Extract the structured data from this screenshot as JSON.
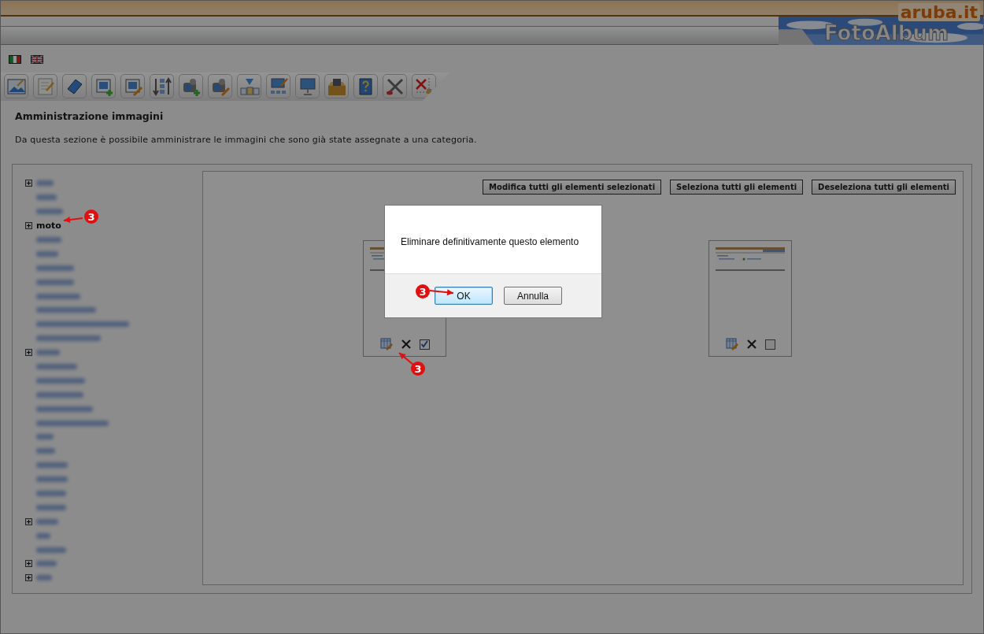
{
  "header": {
    "brand": "aruba.it",
    "title": "FotoAlbum"
  },
  "languages": [
    {
      "kind": "italian"
    },
    {
      "kind": "english"
    }
  ],
  "toolbar": [
    {
      "kind": "gallery"
    },
    {
      "kind": "notes"
    },
    {
      "kind": "book"
    },
    {
      "kind": "image-add"
    },
    {
      "kind": "image-edit"
    },
    {
      "kind": "sort"
    },
    {
      "kind": "camera-add"
    },
    {
      "kind": "camera-edit"
    },
    {
      "kind": "upload"
    },
    {
      "kind": "monitor-edit"
    },
    {
      "kind": "monitor"
    },
    {
      "kind": "box"
    },
    {
      "kind": "help"
    },
    {
      "kind": "tools"
    },
    {
      "kind": "delete"
    }
  ],
  "page": {
    "title": "Amministrazione immagini",
    "description": "Da questa sezione è possibile amministrare le immagini che sono già state assegnate a una categoria."
  },
  "tree": [
    {
      "kind": "blurred",
      "expandable": true
    },
    {
      "kind": "blurred",
      "expandable": false
    },
    {
      "kind": "blurred",
      "expandable": false
    },
    {
      "kind": "label",
      "label": "moto",
      "expandable": true
    },
    {
      "kind": "blurred",
      "expandable": false
    },
    {
      "kind": "blurred",
      "expandable": false
    },
    {
      "kind": "blurred",
      "expandable": false
    },
    {
      "kind": "blurred",
      "expandable": false
    },
    {
      "kind": "blurred",
      "expandable": false
    },
    {
      "kind": "blurred",
      "expandable": false
    },
    {
      "kind": "blurred",
      "expandable": false
    },
    {
      "kind": "blurred",
      "expandable": false
    },
    {
      "kind": "blurred",
      "expandable": true
    },
    {
      "kind": "blurred",
      "expandable": false
    },
    {
      "kind": "blurred",
      "expandable": false
    },
    {
      "kind": "blurred",
      "expandable": false
    },
    {
      "kind": "blurred",
      "expandable": false
    },
    {
      "kind": "blurred",
      "expandable": false
    },
    {
      "kind": "blurred",
      "expandable": false
    },
    {
      "kind": "blurred",
      "expandable": false
    },
    {
      "kind": "blurred",
      "expandable": false
    },
    {
      "kind": "blurred",
      "expandable": false
    },
    {
      "kind": "blurred",
      "expandable": false
    },
    {
      "kind": "blurred",
      "expandable": false
    },
    {
      "kind": "blurred",
      "expandable": true
    },
    {
      "kind": "blurred",
      "expandable": false
    },
    {
      "kind": "blurred",
      "expandable": false
    },
    {
      "kind": "blurred",
      "expandable": true
    },
    {
      "kind": "blurred",
      "expandable": true
    }
  ],
  "actions": [
    "Modifica tutti gli elementi selezionati",
    "Seleziona tutti gli elementi",
    "Deseleziona tutti gli elementi"
  ],
  "items": [
    {
      "kind": "picture",
      "checked": true
    },
    {
      "kind": "picture",
      "checked": false
    }
  ],
  "dialog": {
    "message": "Eliminare definitivamente questo elemento",
    "buttons": [
      "OK",
      "Annulla"
    ]
  },
  "annotations": [
    {
      "label": "3"
    },
    {
      "label": "3"
    },
    {
      "label": "3"
    }
  ]
}
